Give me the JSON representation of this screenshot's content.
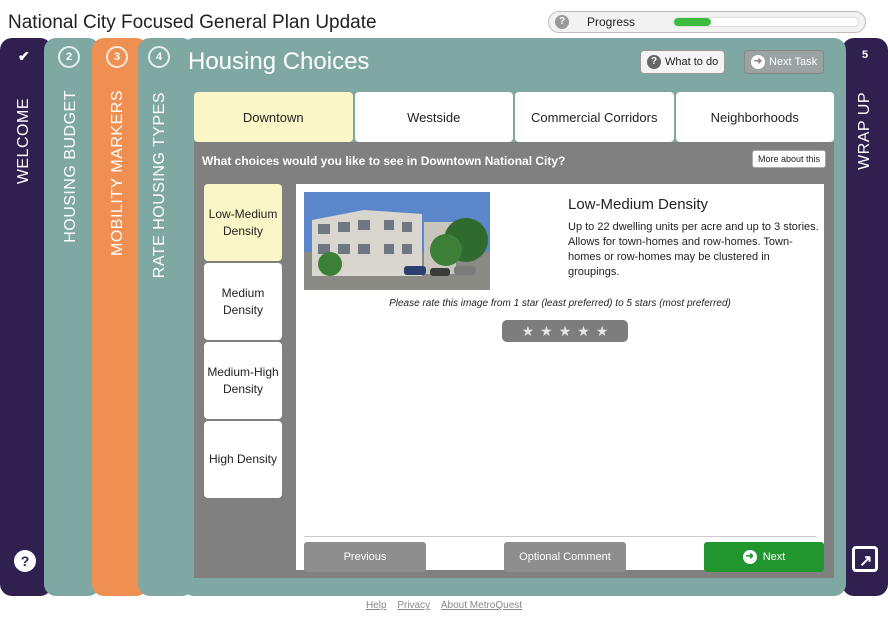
{
  "app_title": "National City Focused General Plan Update",
  "progress": {
    "label": "Progress",
    "help_icon": "?",
    "fraction": 0.2
  },
  "tabs": {
    "welcome": {
      "label": "WELCOME"
    },
    "budget": {
      "number": "2",
      "label": "HOUSING BUDGET"
    },
    "mobility": {
      "number": "3",
      "label": "MOBILITY MARKERS"
    },
    "rate": {
      "number": "4",
      "label": "RATE HOUSING TYPES"
    },
    "wrapup": {
      "number": "5",
      "label": "WRAP UP"
    }
  },
  "main": {
    "title": "Housing Choices",
    "what_to_do": "What to do",
    "next_task": "Next Task",
    "locations": [
      "Downtown",
      "Westside",
      "Commercial Corridors",
      "Neighborhoods"
    ],
    "question": "What choices would you like to see in Downtown National City?",
    "more_about": "More about this",
    "densities": [
      "Low-Medium Density",
      "Medium Density",
      "Medium-High Density",
      "High Density"
    ],
    "selected_title": "Low-Medium Density",
    "selected_desc": "Up to 22 dwelling units per acre and up to 3 stories. Allows for town-homes and row-homes. Town-homes or row-homes may be clustered in groupings.",
    "rate_prompt": "Please rate this image from 1 star (least preferred) to 5 stars (most preferred)",
    "rating": 0,
    "max_rating": 5,
    "previous": "Previous",
    "optional_comment": "Optional Comment",
    "next": "Next"
  },
  "footer": {
    "help": "Help",
    "privacy": "Privacy",
    "about": "About MetroQuest"
  },
  "colors": {
    "teal": "#7fa8a3",
    "orange": "#ef8f52",
    "navy": "#2f2050",
    "active_tab": "#fbf6c7",
    "next_green": "#22962e"
  }
}
